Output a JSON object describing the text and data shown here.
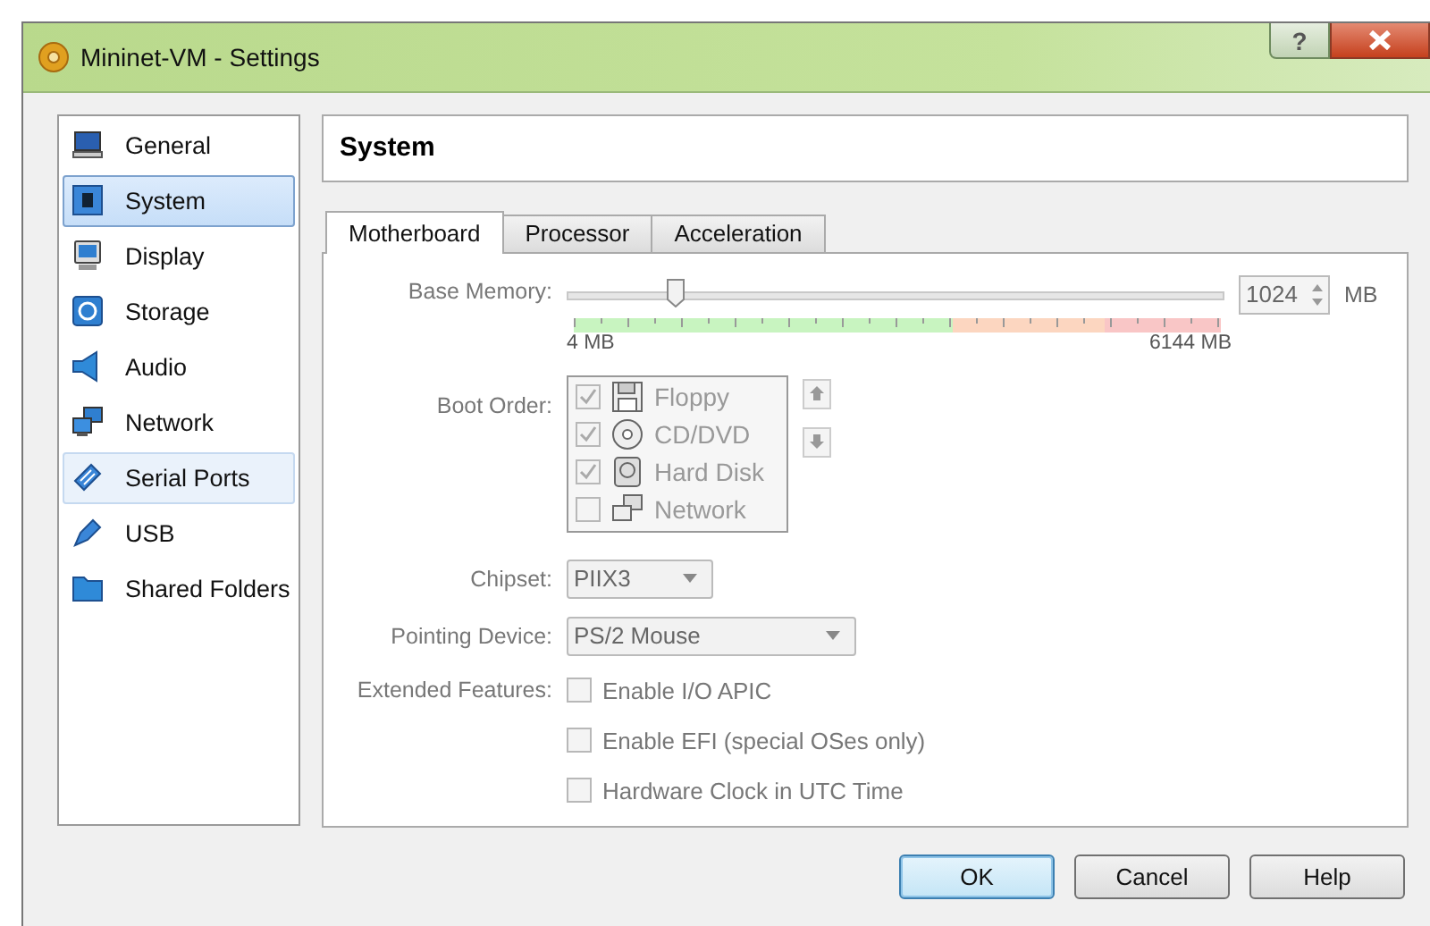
{
  "window": {
    "title": "Mininet-VM - Settings",
    "help": "?"
  },
  "sidebar": {
    "items": [
      {
        "label": "General",
        "kind": "general",
        "selected": false,
        "hovered": false
      },
      {
        "label": "System",
        "kind": "system",
        "selected": true,
        "hovered": false
      },
      {
        "label": "Display",
        "kind": "display",
        "selected": false,
        "hovered": false
      },
      {
        "label": "Storage",
        "kind": "storage",
        "selected": false,
        "hovered": false
      },
      {
        "label": "Audio",
        "kind": "audio",
        "selected": false,
        "hovered": false
      },
      {
        "label": "Network",
        "kind": "network",
        "selected": false,
        "hovered": false
      },
      {
        "label": "Serial Ports",
        "kind": "serial",
        "selected": false,
        "hovered": true
      },
      {
        "label": "USB",
        "kind": "usb",
        "selected": false,
        "hovered": false
      },
      {
        "label": "Shared Folders",
        "kind": "folder",
        "selected": false,
        "hovered": false
      }
    ]
  },
  "page_title": "System",
  "tabs": [
    {
      "label": "Motherboard",
      "selected": true
    },
    {
      "label": "Processor",
      "selected": false
    },
    {
      "label": "Acceleration",
      "selected": false
    }
  ],
  "base_memory": {
    "label": "Base Memory:",
    "level": 0.167,
    "min_label": "4 MB",
    "max_label": "6144 MB",
    "value": "1024",
    "unit": "MB"
  },
  "boot_order": {
    "label": "Boot Order:",
    "items": [
      {
        "label": "Floppy",
        "kind": "floppy",
        "checked": true
      },
      {
        "label": "CD/DVD",
        "kind": "cd",
        "checked": true
      },
      {
        "label": "Hard Disk",
        "kind": "disk",
        "checked": true
      },
      {
        "label": "Network",
        "kind": "network",
        "checked": false
      }
    ]
  },
  "chipset": {
    "label": "Chipset:",
    "value": "PIIX3"
  },
  "pointing_device": {
    "label": "Pointing Device:",
    "value": "PS/2 Mouse"
  },
  "extended_features": {
    "label": "Extended Features:",
    "options": [
      {
        "label": "Enable I/O APIC",
        "checked": false
      },
      {
        "label": "Enable EFI (special OSes only)",
        "checked": false
      },
      {
        "label": "Hardware Clock in UTC Time",
        "checked": false
      }
    ]
  },
  "buttons": [
    {
      "label": "OK",
      "default": true
    },
    {
      "label": "Cancel",
      "default": false
    },
    {
      "label": "Help",
      "default": false
    }
  ]
}
